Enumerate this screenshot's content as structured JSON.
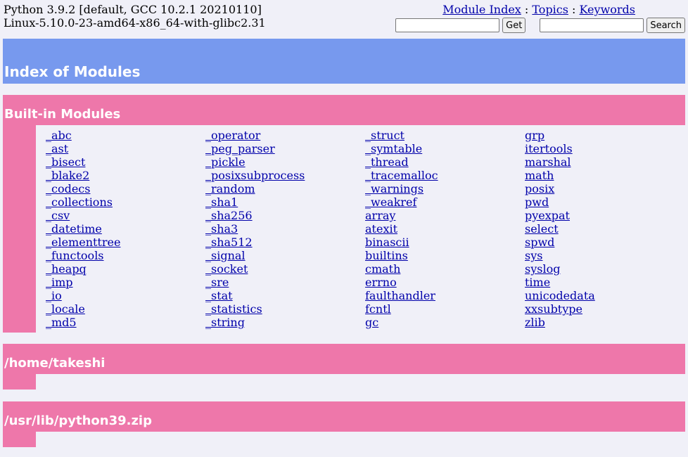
{
  "header": {
    "version_line": "Python 3.9.2 [default, GCC 10.2.1 20210110]",
    "platform_line": "Linux-5.10.0-23-amd64-x86_64-with-glibc2.31",
    "links": [
      "Module Index",
      "Topics",
      "Keywords"
    ],
    "separator": " : ",
    "get_input_value": "",
    "get_label": "Get",
    "search_input_value": "",
    "search_label": "Search"
  },
  "colors": {
    "title_bar": "#7799ee",
    "section_bar": "#ee77aa",
    "background": "#f0f0f8",
    "link": "#0000aa"
  },
  "title": "Index of Modules",
  "sections": [
    {
      "title": "Built-in Modules",
      "modules": [
        "_abc",
        "_ast",
        "_bisect",
        "_blake2",
        "_codecs",
        "_collections",
        "_csv",
        "_datetime",
        "_elementtree",
        "_functools",
        "_heapq",
        "_imp",
        "_io",
        "_locale",
        "_md5",
        "_operator",
        "_peg_parser",
        "_pickle",
        "_posixsubprocess",
        "_random",
        "_sha1",
        "_sha256",
        "_sha3",
        "_sha512",
        "_signal",
        "_socket",
        "_sre",
        "_stat",
        "_statistics",
        "_string",
        "_struct",
        "_symtable",
        "_thread",
        "_tracemalloc",
        "_warnings",
        "_weakref",
        "array",
        "atexit",
        "binascii",
        "builtins",
        "cmath",
        "errno",
        "faulthandler",
        "fcntl",
        "gc",
        "grp",
        "itertools",
        "marshal",
        "math",
        "posix",
        "pwd",
        "pyexpat",
        "select",
        "spwd",
        "sys",
        "syslog",
        "time",
        "unicodedata",
        "xxsubtype",
        "zlib"
      ]
    },
    {
      "title": "/home/takeshi",
      "modules": []
    },
    {
      "title": "/usr/lib/python39.zip",
      "modules": []
    }
  ]
}
